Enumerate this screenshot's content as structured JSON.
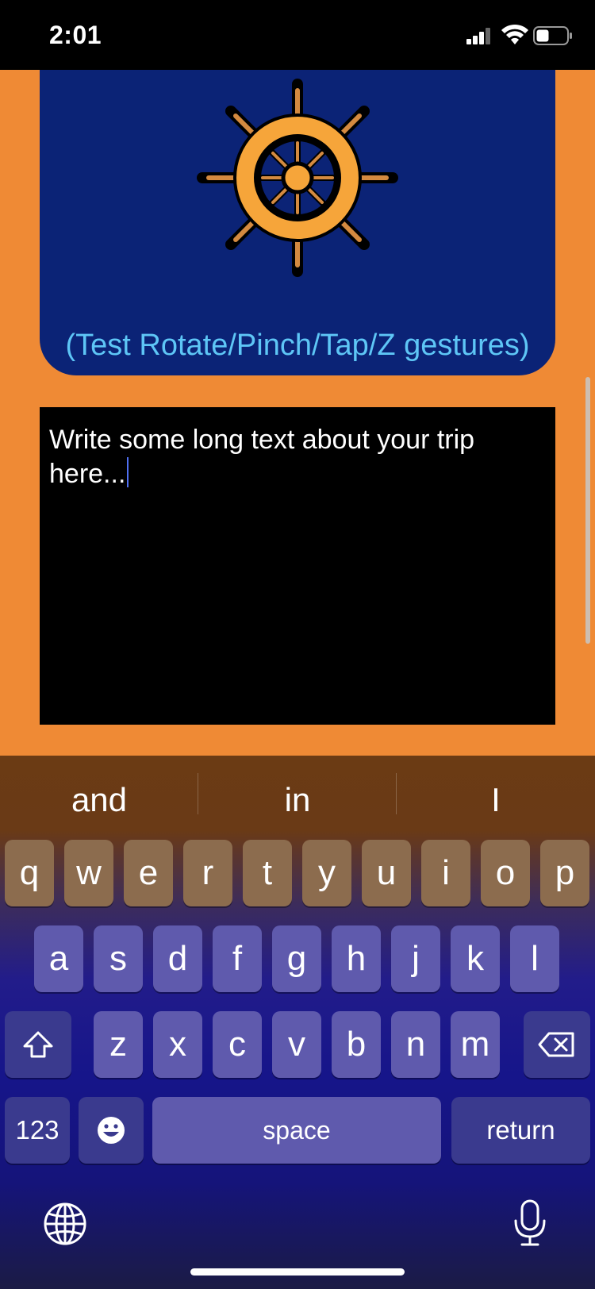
{
  "status": {
    "time": "2:01"
  },
  "card": {
    "gesture_label": "(Test Rotate/Pinch/Tap/Z gestures)",
    "image_icon": "ship-wheel-icon"
  },
  "text_area": {
    "text": "Write some long text about your trip here..."
  },
  "keyboard": {
    "suggestions": [
      "and",
      "in",
      "I"
    ],
    "row1": [
      "q",
      "w",
      "e",
      "r",
      "t",
      "y",
      "u",
      "i",
      "o",
      "p"
    ],
    "row2": [
      "a",
      "s",
      "d",
      "f",
      "g",
      "h",
      "j",
      "k",
      "l"
    ],
    "row3": [
      "z",
      "x",
      "c",
      "v",
      "b",
      "n",
      "m"
    ],
    "numbers_label": "123",
    "space_label": "space",
    "return_label": "return",
    "icons": [
      "shift-icon",
      "backspace-icon",
      "emoji-icon",
      "globe-icon",
      "microphone-icon"
    ]
  },
  "colors": {
    "background": "#ef8a35",
    "card": "#0b2376",
    "label": "#5ec6f6",
    "text_area": "#000000"
  }
}
